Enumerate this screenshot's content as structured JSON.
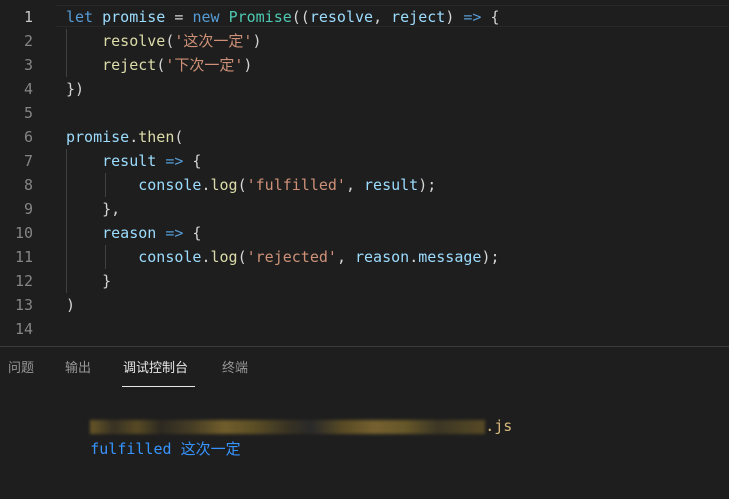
{
  "editor": {
    "active_line": 1,
    "lines": [
      {
        "n": "1",
        "tokens": [
          {
            "t": "let",
            "c": "kw"
          },
          {
            "t": " ",
            "c": "pun"
          },
          {
            "t": "promise",
            "c": "var"
          },
          {
            "t": " = ",
            "c": "pun"
          },
          {
            "t": "new",
            "c": "kw"
          },
          {
            "t": " ",
            "c": "pun"
          },
          {
            "t": "Promise",
            "c": "cls"
          },
          {
            "t": "((",
            "c": "pun"
          },
          {
            "t": "resolve",
            "c": "var"
          },
          {
            "t": ", ",
            "c": "pun"
          },
          {
            "t": "reject",
            "c": "var"
          },
          {
            "t": ") ",
            "c": "pun"
          },
          {
            "t": "=>",
            "c": "kw"
          },
          {
            "t": " {",
            "c": "pun"
          }
        ]
      },
      {
        "n": "2",
        "tokens": [
          {
            "t": "    ",
            "c": "pun"
          },
          {
            "t": "resolve",
            "c": "fn"
          },
          {
            "t": "(",
            "c": "pun"
          },
          {
            "t": "'这次一定'",
            "c": "str"
          },
          {
            "t": ")",
            "c": "pun"
          }
        ]
      },
      {
        "n": "3",
        "tokens": [
          {
            "t": "    ",
            "c": "pun"
          },
          {
            "t": "reject",
            "c": "fn"
          },
          {
            "t": "(",
            "c": "pun"
          },
          {
            "t": "'下次一定'",
            "c": "str"
          },
          {
            "t": ")",
            "c": "pun"
          }
        ]
      },
      {
        "n": "4",
        "tokens": [
          {
            "t": "})",
            "c": "pun"
          }
        ]
      },
      {
        "n": "5",
        "tokens": []
      },
      {
        "n": "6",
        "tokens": [
          {
            "t": "promise",
            "c": "var"
          },
          {
            "t": ".",
            "c": "pun"
          },
          {
            "t": "then",
            "c": "fn"
          },
          {
            "t": "(",
            "c": "pun"
          }
        ]
      },
      {
        "n": "7",
        "tokens": [
          {
            "t": "    ",
            "c": "pun"
          },
          {
            "t": "result",
            "c": "var"
          },
          {
            "t": " ",
            "c": "pun"
          },
          {
            "t": "=>",
            "c": "kw"
          },
          {
            "t": " {",
            "c": "pun"
          }
        ]
      },
      {
        "n": "8",
        "tokens": [
          {
            "t": "        ",
            "c": "pun"
          },
          {
            "t": "console",
            "c": "var"
          },
          {
            "t": ".",
            "c": "pun"
          },
          {
            "t": "log",
            "c": "fn"
          },
          {
            "t": "(",
            "c": "pun"
          },
          {
            "t": "'fulfilled'",
            "c": "str"
          },
          {
            "t": ", ",
            "c": "pun"
          },
          {
            "t": "result",
            "c": "var"
          },
          {
            "t": ");",
            "c": "pun"
          }
        ]
      },
      {
        "n": "9",
        "tokens": [
          {
            "t": "    },",
            "c": "pun"
          }
        ]
      },
      {
        "n": "10",
        "tokens": [
          {
            "t": "    ",
            "c": "pun"
          },
          {
            "t": "reason",
            "c": "var"
          },
          {
            "t": " ",
            "c": "pun"
          },
          {
            "t": "=>",
            "c": "kw"
          },
          {
            "t": " {",
            "c": "pun"
          }
        ]
      },
      {
        "n": "11",
        "tokens": [
          {
            "t": "        ",
            "c": "pun"
          },
          {
            "t": "console",
            "c": "var"
          },
          {
            "t": ".",
            "c": "pun"
          },
          {
            "t": "log",
            "c": "fn"
          },
          {
            "t": "(",
            "c": "pun"
          },
          {
            "t": "'rejected'",
            "c": "str"
          },
          {
            "t": ", ",
            "c": "pun"
          },
          {
            "t": "reason",
            "c": "var"
          },
          {
            "t": ".",
            "c": "pun"
          },
          {
            "t": "message",
            "c": "var"
          },
          {
            "t": ");",
            "c": "pun"
          }
        ]
      },
      {
        "n": "12",
        "tokens": [
          {
            "t": "    }",
            "c": "pun"
          }
        ]
      },
      {
        "n": "13",
        "tokens": [
          {
            "t": ")",
            "c": "pun"
          }
        ]
      },
      {
        "n": "14",
        "tokens": []
      }
    ]
  },
  "panel": {
    "tabs": [
      {
        "label": "问题",
        "active": false
      },
      {
        "label": "输出",
        "active": false
      },
      {
        "label": "调试控制台",
        "active": true
      },
      {
        "label": "终端",
        "active": false
      }
    ],
    "console": {
      "source_suffix": ".js",
      "output_label": "fulfilled",
      "output_value": "这次一定"
    }
  },
  "colors": {
    "background": "#1e1e1e",
    "keyword": "#569cd6",
    "variable": "#9cdcfe",
    "class": "#4ec9b0",
    "function": "#dcdcaa",
    "string": "#ce9178",
    "line_number": "#858585",
    "console_output": "#3794ff",
    "source_link": "#d7ba7d"
  }
}
